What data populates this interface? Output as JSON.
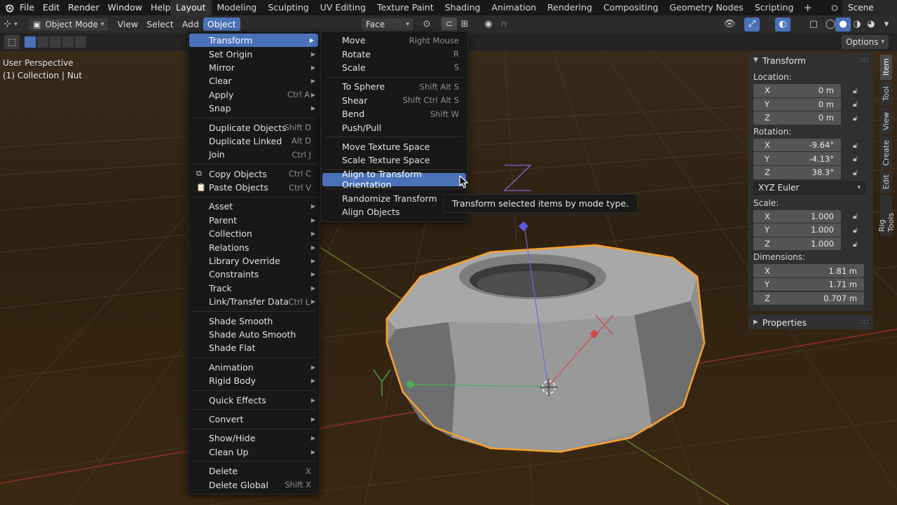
{
  "topbar": {
    "menus": [
      "File",
      "Edit",
      "Render",
      "Window",
      "Help"
    ],
    "workspaces": [
      "Layout",
      "Modeling",
      "Sculpting",
      "UV Editing",
      "Texture Paint",
      "Shading",
      "Animation",
      "Rendering",
      "Compositing",
      "Geometry Nodes",
      "Scripting"
    ],
    "active_workspace": "Layout",
    "add_workspace": "+",
    "scene": "Scene"
  },
  "viewport_header": {
    "mode": "Object Mode",
    "menus": [
      "View",
      "Select",
      "Add",
      "Object"
    ],
    "active_menu": "Object",
    "snap_target": "Face"
  },
  "tool_header": {
    "options": "Options"
  },
  "viewport": {
    "perspective": "User Perspective",
    "collection": "(1) Collection | Nut"
  },
  "object_menu": {
    "groups": [
      [
        {
          "label": "Transform",
          "submenu": true,
          "highlight": true
        },
        {
          "label": "Set Origin",
          "submenu": true
        },
        {
          "label": "Mirror",
          "submenu": true
        },
        {
          "label": "Clear",
          "submenu": true
        },
        {
          "label": "Apply",
          "shortcut": "Ctrl A",
          "submenu": true
        },
        {
          "label": "Snap",
          "submenu": true
        }
      ],
      [
        {
          "label": "Duplicate Objects",
          "shortcut": "Shift D"
        },
        {
          "label": "Duplicate Linked",
          "shortcut": "Alt D"
        },
        {
          "label": "Join",
          "shortcut": "Ctrl J"
        }
      ],
      [
        {
          "label": "Copy Objects",
          "shortcut": "Ctrl C",
          "icon": "copy-icon"
        },
        {
          "label": "Paste Objects",
          "shortcut": "Ctrl V",
          "icon": "paste-icon"
        }
      ],
      [
        {
          "label": "Asset",
          "submenu": true
        },
        {
          "label": "Parent",
          "submenu": true
        },
        {
          "label": "Collection",
          "submenu": true
        },
        {
          "label": "Relations",
          "submenu": true
        },
        {
          "label": "Library Override",
          "submenu": true
        },
        {
          "label": "Constraints",
          "submenu": true
        },
        {
          "label": "Track",
          "submenu": true
        },
        {
          "label": "Link/Transfer Data",
          "shortcut": "Ctrl L",
          "submenu": true
        }
      ],
      [
        {
          "label": "Shade Smooth"
        },
        {
          "label": "Shade Auto Smooth"
        },
        {
          "label": "Shade Flat"
        }
      ],
      [
        {
          "label": "Animation",
          "submenu": true
        },
        {
          "label": "Rigid Body",
          "submenu": true
        }
      ],
      [
        {
          "label": "Quick Effects",
          "submenu": true
        }
      ],
      [
        {
          "label": "Convert",
          "submenu": true
        }
      ],
      [
        {
          "label": "Show/Hide",
          "submenu": true
        },
        {
          "label": "Clean Up",
          "submenu": true
        }
      ],
      [
        {
          "label": "Delete",
          "shortcut": "X"
        },
        {
          "label": "Delete Global",
          "shortcut": "Shift X"
        }
      ]
    ]
  },
  "transform_submenu": {
    "groups": [
      [
        {
          "label": "Move",
          "shortcut": "Right Mouse"
        },
        {
          "label": "Rotate",
          "shortcut": "R"
        },
        {
          "label": "Scale",
          "shortcut": "S"
        }
      ],
      [
        {
          "label": "To Sphere",
          "shortcut": "Shift Alt S"
        },
        {
          "label": "Shear",
          "shortcut": "Shift Ctrl Alt S"
        },
        {
          "label": "Bend",
          "shortcut": "Shift W"
        },
        {
          "label": "Push/Pull"
        }
      ],
      [
        {
          "label": "Move Texture Space"
        },
        {
          "label": "Scale Texture Space"
        }
      ],
      [
        {
          "label": "Align to Transform Orientation",
          "highlight": true
        }
      ],
      [
        {
          "label": "Randomize Transform"
        },
        {
          "label": "Align Objects"
        }
      ]
    ]
  },
  "tooltip": "Transform selected items by mode type.",
  "npanel": {
    "transform_title": "Transform",
    "location_label": "Location:",
    "location": [
      {
        "axis": "X",
        "value": "0 m"
      },
      {
        "axis": "Y",
        "value": "0 m"
      },
      {
        "axis": "Z",
        "value": "0 m"
      }
    ],
    "rotation_label": "Rotation:",
    "rotation": [
      {
        "axis": "X",
        "value": "-9.64°"
      },
      {
        "axis": "Y",
        "value": "-4.13°"
      },
      {
        "axis": "Z",
        "value": "38.3°"
      }
    ],
    "rotation_mode": "XYZ Euler",
    "scale_label": "Scale:",
    "scale": [
      {
        "axis": "X",
        "value": "1.000"
      },
      {
        "axis": "Y",
        "value": "1.000"
      },
      {
        "axis": "Z",
        "value": "1.000"
      }
    ],
    "dimensions_label": "Dimensions:",
    "dimensions": [
      {
        "axis": "X",
        "value": "1.81 m"
      },
      {
        "axis": "Y",
        "value": "1.71 m"
      },
      {
        "axis": "Z",
        "value": "0.707 m"
      }
    ],
    "properties_title": "Properties"
  },
  "side_tabs": [
    "Item",
    "Tool",
    "View",
    "Create",
    "Edit",
    "Rig Tools"
  ],
  "active_side_tab": "Item",
  "gizmo_labels": {
    "y": "Y",
    "z": "Z"
  },
  "colors": {
    "accent": "#4a72b8",
    "selection_outline": "#f5a030",
    "menu_bg": "#181818"
  }
}
